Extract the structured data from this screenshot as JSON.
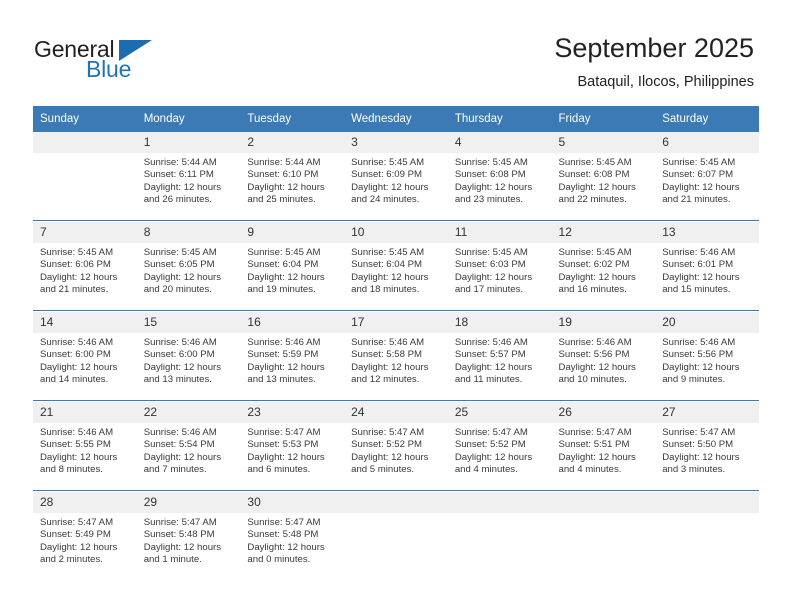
{
  "brand": {
    "name_part1": "General",
    "name_part2": "Blue",
    "accent_color": "#1b75bb"
  },
  "header": {
    "title": "September 2025",
    "subtitle": "Bataquil, Ilocos, Philippines"
  },
  "calendar": {
    "header_color": "#3b7ab5",
    "weekdays": [
      "Sunday",
      "Monday",
      "Tuesday",
      "Wednesday",
      "Thursday",
      "Friday",
      "Saturday"
    ],
    "weeks": [
      [
        {
          "day": "",
          "sunrise": "",
          "sunset": "",
          "daylight1": "",
          "daylight2": ""
        },
        {
          "day": "1",
          "sunrise": "Sunrise: 5:44 AM",
          "sunset": "Sunset: 6:11 PM",
          "daylight1": "Daylight: 12 hours",
          "daylight2": "and 26 minutes."
        },
        {
          "day": "2",
          "sunrise": "Sunrise: 5:44 AM",
          "sunset": "Sunset: 6:10 PM",
          "daylight1": "Daylight: 12 hours",
          "daylight2": "and 25 minutes."
        },
        {
          "day": "3",
          "sunrise": "Sunrise: 5:45 AM",
          "sunset": "Sunset: 6:09 PM",
          "daylight1": "Daylight: 12 hours",
          "daylight2": "and 24 minutes."
        },
        {
          "day": "4",
          "sunrise": "Sunrise: 5:45 AM",
          "sunset": "Sunset: 6:08 PM",
          "daylight1": "Daylight: 12 hours",
          "daylight2": "and 23 minutes."
        },
        {
          "day": "5",
          "sunrise": "Sunrise: 5:45 AM",
          "sunset": "Sunset: 6:08 PM",
          "daylight1": "Daylight: 12 hours",
          "daylight2": "and 22 minutes."
        },
        {
          "day": "6",
          "sunrise": "Sunrise: 5:45 AM",
          "sunset": "Sunset: 6:07 PM",
          "daylight1": "Daylight: 12 hours",
          "daylight2": "and 21 minutes."
        }
      ],
      [
        {
          "day": "7",
          "sunrise": "Sunrise: 5:45 AM",
          "sunset": "Sunset: 6:06 PM",
          "daylight1": "Daylight: 12 hours",
          "daylight2": "and 21 minutes."
        },
        {
          "day": "8",
          "sunrise": "Sunrise: 5:45 AM",
          "sunset": "Sunset: 6:05 PM",
          "daylight1": "Daylight: 12 hours",
          "daylight2": "and 20 minutes."
        },
        {
          "day": "9",
          "sunrise": "Sunrise: 5:45 AM",
          "sunset": "Sunset: 6:04 PM",
          "daylight1": "Daylight: 12 hours",
          "daylight2": "and 19 minutes."
        },
        {
          "day": "10",
          "sunrise": "Sunrise: 5:45 AM",
          "sunset": "Sunset: 6:04 PM",
          "daylight1": "Daylight: 12 hours",
          "daylight2": "and 18 minutes."
        },
        {
          "day": "11",
          "sunrise": "Sunrise: 5:45 AM",
          "sunset": "Sunset: 6:03 PM",
          "daylight1": "Daylight: 12 hours",
          "daylight2": "and 17 minutes."
        },
        {
          "day": "12",
          "sunrise": "Sunrise: 5:45 AM",
          "sunset": "Sunset: 6:02 PM",
          "daylight1": "Daylight: 12 hours",
          "daylight2": "and 16 minutes."
        },
        {
          "day": "13",
          "sunrise": "Sunrise: 5:46 AM",
          "sunset": "Sunset: 6:01 PM",
          "daylight1": "Daylight: 12 hours",
          "daylight2": "and 15 minutes."
        }
      ],
      [
        {
          "day": "14",
          "sunrise": "Sunrise: 5:46 AM",
          "sunset": "Sunset: 6:00 PM",
          "daylight1": "Daylight: 12 hours",
          "daylight2": "and 14 minutes."
        },
        {
          "day": "15",
          "sunrise": "Sunrise: 5:46 AM",
          "sunset": "Sunset: 6:00 PM",
          "daylight1": "Daylight: 12 hours",
          "daylight2": "and 13 minutes."
        },
        {
          "day": "16",
          "sunrise": "Sunrise: 5:46 AM",
          "sunset": "Sunset: 5:59 PM",
          "daylight1": "Daylight: 12 hours",
          "daylight2": "and 13 minutes."
        },
        {
          "day": "17",
          "sunrise": "Sunrise: 5:46 AM",
          "sunset": "Sunset: 5:58 PM",
          "daylight1": "Daylight: 12 hours",
          "daylight2": "and 12 minutes."
        },
        {
          "day": "18",
          "sunrise": "Sunrise: 5:46 AM",
          "sunset": "Sunset: 5:57 PM",
          "daylight1": "Daylight: 12 hours",
          "daylight2": "and 11 minutes."
        },
        {
          "day": "19",
          "sunrise": "Sunrise: 5:46 AM",
          "sunset": "Sunset: 5:56 PM",
          "daylight1": "Daylight: 12 hours",
          "daylight2": "and 10 minutes."
        },
        {
          "day": "20",
          "sunrise": "Sunrise: 5:46 AM",
          "sunset": "Sunset: 5:56 PM",
          "daylight1": "Daylight: 12 hours",
          "daylight2": "and 9 minutes."
        }
      ],
      [
        {
          "day": "21",
          "sunrise": "Sunrise: 5:46 AM",
          "sunset": "Sunset: 5:55 PM",
          "daylight1": "Daylight: 12 hours",
          "daylight2": "and 8 minutes."
        },
        {
          "day": "22",
          "sunrise": "Sunrise: 5:46 AM",
          "sunset": "Sunset: 5:54 PM",
          "daylight1": "Daylight: 12 hours",
          "daylight2": "and 7 minutes."
        },
        {
          "day": "23",
          "sunrise": "Sunrise: 5:47 AM",
          "sunset": "Sunset: 5:53 PM",
          "daylight1": "Daylight: 12 hours",
          "daylight2": "and 6 minutes."
        },
        {
          "day": "24",
          "sunrise": "Sunrise: 5:47 AM",
          "sunset": "Sunset: 5:52 PM",
          "daylight1": "Daylight: 12 hours",
          "daylight2": "and 5 minutes."
        },
        {
          "day": "25",
          "sunrise": "Sunrise: 5:47 AM",
          "sunset": "Sunset: 5:52 PM",
          "daylight1": "Daylight: 12 hours",
          "daylight2": "and 4 minutes."
        },
        {
          "day": "26",
          "sunrise": "Sunrise: 5:47 AM",
          "sunset": "Sunset: 5:51 PM",
          "daylight1": "Daylight: 12 hours",
          "daylight2": "and 4 minutes."
        },
        {
          "day": "27",
          "sunrise": "Sunrise: 5:47 AM",
          "sunset": "Sunset: 5:50 PM",
          "daylight1": "Daylight: 12 hours",
          "daylight2": "and 3 minutes."
        }
      ],
      [
        {
          "day": "28",
          "sunrise": "Sunrise: 5:47 AM",
          "sunset": "Sunset: 5:49 PM",
          "daylight1": "Daylight: 12 hours",
          "daylight2": "and 2 minutes."
        },
        {
          "day": "29",
          "sunrise": "Sunrise: 5:47 AM",
          "sunset": "Sunset: 5:48 PM",
          "daylight1": "Daylight: 12 hours",
          "daylight2": "and 1 minute."
        },
        {
          "day": "30",
          "sunrise": "Sunrise: 5:47 AM",
          "sunset": "Sunset: 5:48 PM",
          "daylight1": "Daylight: 12 hours",
          "daylight2": "and 0 minutes."
        },
        {
          "day": "",
          "sunrise": "",
          "sunset": "",
          "daylight1": "",
          "daylight2": ""
        },
        {
          "day": "",
          "sunrise": "",
          "sunset": "",
          "daylight1": "",
          "daylight2": ""
        },
        {
          "day": "",
          "sunrise": "",
          "sunset": "",
          "daylight1": "",
          "daylight2": ""
        },
        {
          "day": "",
          "sunrise": "",
          "sunset": "",
          "daylight1": "",
          "daylight2": ""
        }
      ]
    ]
  }
}
